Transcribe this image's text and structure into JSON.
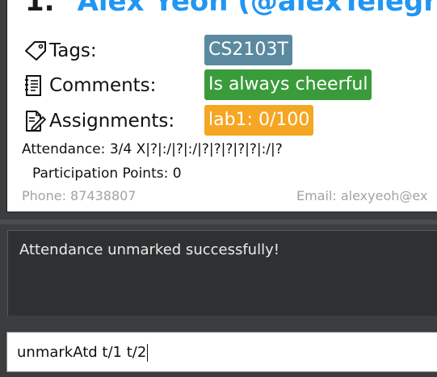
{
  "person": {
    "index": "1.",
    "name": "Alex Yeoh (@alexTelegram)",
    "tags_label": "Tags:",
    "tag": "CS2103T",
    "comments_label": "Comments:",
    "comment": "Is always cheerful",
    "assignments_label": "Assignments:",
    "assignment": "lab1: 0/100",
    "attendance": "Attendance: 3/4  X|?|:/|?|:/|?|?|?|?|?|:/|?",
    "participation": "Participation Points: 0",
    "phone": "Phone: 87438807",
    "email": "Email: alexyeoh@ex"
  },
  "result": {
    "message": "Attendance unmarked successfully!"
  },
  "command": {
    "value": "unmarkAtd t/1 t/2"
  },
  "colors": {
    "name": "#2196f3",
    "tag_chip": "#5b8aa0",
    "comment_chip": "#3a9b3a",
    "assignment_chip": "#f5a623",
    "background": "#3c3d3f"
  },
  "icons": [
    "tag-icon",
    "notebook-icon",
    "assignment-edit-icon"
  ]
}
